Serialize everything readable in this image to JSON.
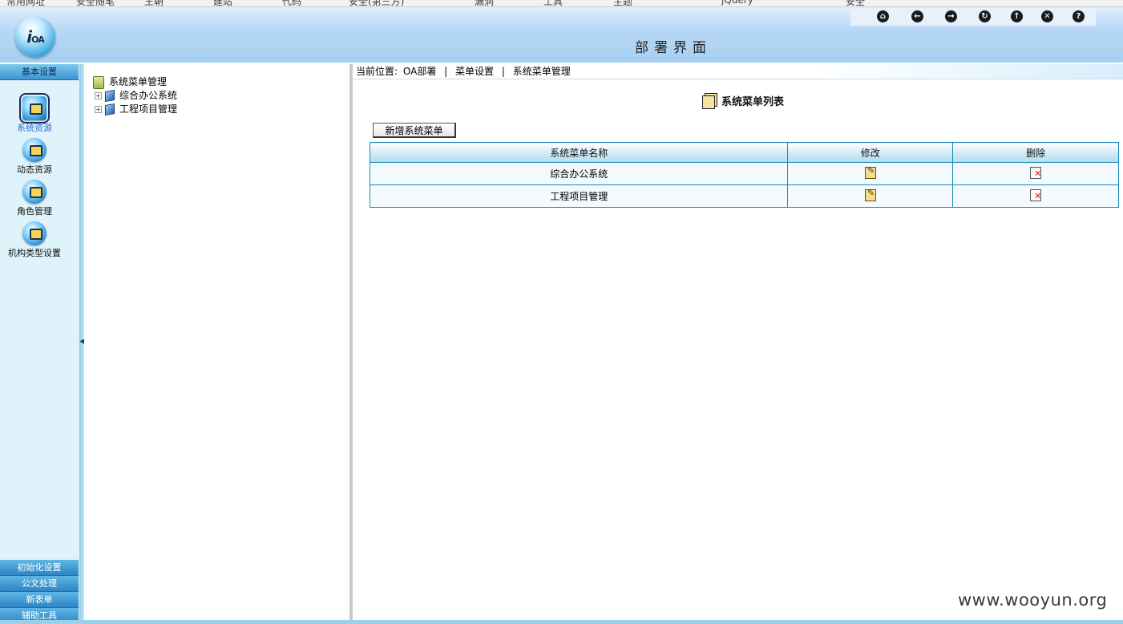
{
  "browser": {
    "bookmarks": [
      "常用网址",
      "安全随笔",
      "王朝",
      "建站",
      "代码",
      "安全(第三方)",
      "漏洞",
      "工具",
      "主题",
      "jQuery",
      "安全"
    ]
  },
  "header": {
    "logo_text": "OA",
    "title": "部署界面",
    "toolbar": [
      {
        "icon": "home-icon",
        "glyph": "⌂"
      },
      {
        "icon": "back-icon",
        "glyph": "←"
      },
      {
        "icon": "forward-icon",
        "glyph": "→"
      },
      {
        "icon": "refresh-icon",
        "glyph": "↻"
      },
      {
        "icon": "up-icon",
        "glyph": "↑"
      },
      {
        "icon": "close-icon",
        "glyph": "✕"
      },
      {
        "icon": "help-icon",
        "glyph": "?"
      }
    ]
  },
  "leftnav": {
    "top_section": "基本设置",
    "items": [
      {
        "label": "系统资源",
        "selected": true
      },
      {
        "label": "动态资源",
        "selected": false
      },
      {
        "label": "角色管理",
        "selected": false
      },
      {
        "label": "机构类型设置",
        "selected": false
      }
    ],
    "bottom_sections": [
      "初始化设置",
      "公文处理",
      "新表单",
      "辅助工具"
    ]
  },
  "tree": {
    "root": "系统菜单管理",
    "children": [
      "综合办公系统",
      "工程项目管理"
    ]
  },
  "main": {
    "breadcrumb": {
      "prefix": "当前位置:",
      "items": [
        "OA部署",
        "菜单设置",
        "系统菜单管理"
      ],
      "separator": "|"
    },
    "list_title": "系统菜单列表",
    "add_button": "新增系统菜单",
    "table": {
      "columns": [
        "系统菜单名称",
        "修改",
        "删除"
      ],
      "rows": [
        {
          "name": "综合办公系统"
        },
        {
          "name": "工程项目管理"
        }
      ]
    }
  },
  "watermark": "www.wooyun.org",
  "colors": {
    "accent_blue": "#1a8ab5",
    "nav_bg": "#dff3fb",
    "selected_label": "#2b6fd1"
  }
}
